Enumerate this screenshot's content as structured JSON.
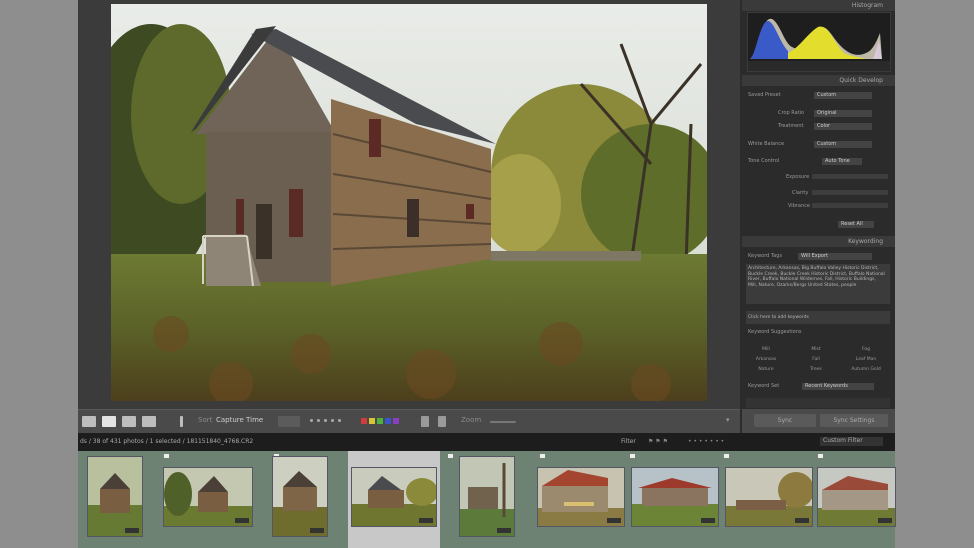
{
  "right_panel": {
    "histogram_label": "Histogram",
    "quick_develop": {
      "title": "Quick Develop",
      "saved_preset_label": "Saved Preset",
      "saved_preset_value": "Custom",
      "crop_ratio_label": "Crop Ratio",
      "crop_ratio_value": "Original",
      "treatment_label": "Treatment",
      "treatment_value": "Color",
      "white_balance_label": "White Balance",
      "white_balance_value": "Custom",
      "tone_control_label": "Tone Control",
      "tone_control_value": "Auto Tone",
      "exposure_label": "Exposure",
      "clarity_label": "Clarity",
      "vibrance_label": "Vibrance",
      "reset_all_label": "Reset All"
    },
    "keywording": {
      "title": "Keywording",
      "keyword_tags_label": "Keyword Tags",
      "keyword_tags_value": "Will Export",
      "keywords_text": "Architecture, Arkansas, Big Buffalo Valley Historic District, Buckle Creek, Buckle Creek Historic District, Buffalo National River, Buffalo National Wildernes, Fall, Historic Buildings, Mill, Nature, Ozarks/Bergs United States, people",
      "click_here_text": "Click here to add keywords",
      "suggestions_label": "Keyword Suggestions",
      "suggestions": [
        "Mill",
        "Mist",
        "Fog",
        "Arkansas",
        "Fall",
        "Leaf Man",
        "Nature",
        "Trees",
        "Autumn Gold"
      ],
      "keyword_set_label": "Keyword Set",
      "keyword_set_value": "Recent Keywords"
    },
    "sync_label": "Sync",
    "sync_settings_label": "Sync Settings"
  },
  "toolbar": {
    "sort_label": "Sort",
    "sort_value": "Capture Time",
    "zoom_label": "Zoom"
  },
  "filmstrip_bar": {
    "info": "ds / 38 of 431 photos / 1 selected / 181151840_4768.CR2",
    "filter_label": "Filter",
    "filter_value": "Custom Filter"
  },
  "colors": {
    "background": "#8e8e8e",
    "panel": "#2b2b2b",
    "filmstrip": "#6e8274",
    "selected_cell": "#c8c8c8"
  }
}
